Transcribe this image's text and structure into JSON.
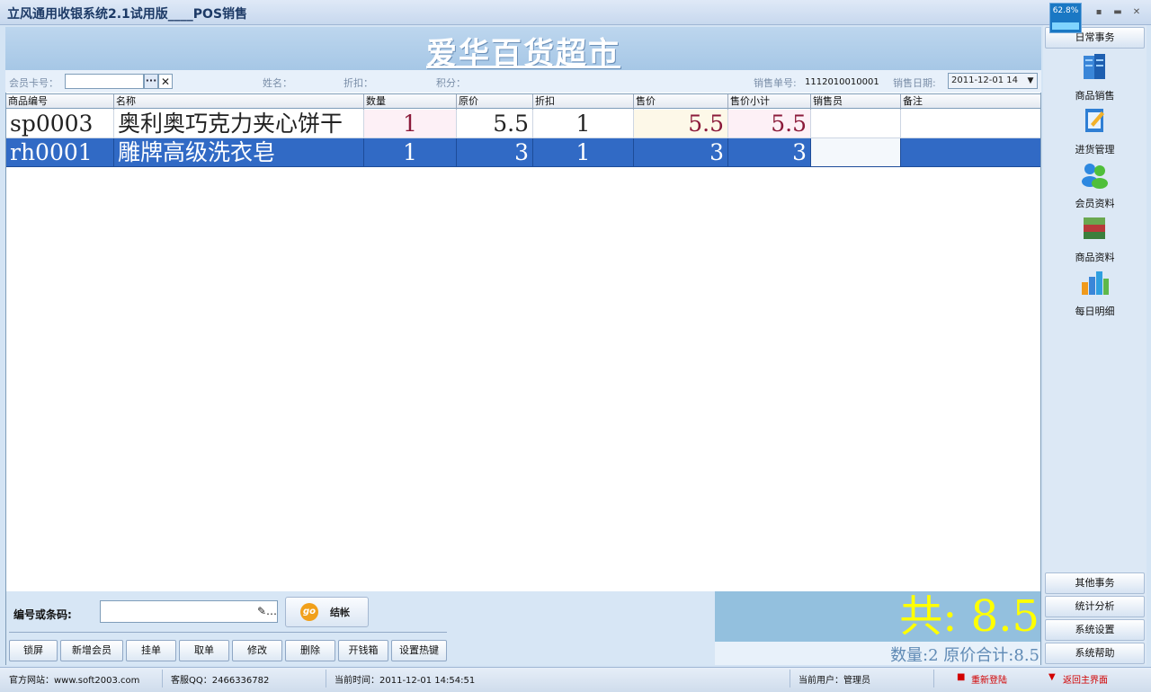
{
  "window": {
    "title": "立风通用收银系统2.1试用版____POS销售",
    "perf_value": "62.8%",
    "minimize": "▪",
    "maximize": "▬",
    "close": "✕"
  },
  "store": {
    "name": "爱华百货超市"
  },
  "member_bar": {
    "card_label": "会员卡号：",
    "card_value": "",
    "dots_label": "···",
    "clear_label": "✕",
    "name_label": "姓名：",
    "discount_label": "折扣：",
    "points_label": "积分：",
    "order_no_label": "销售单号:",
    "order_no": "1112010010001",
    "date_label": "销售日期:",
    "date_value": "2011-12-01 14",
    "date_arrow": "▼"
  },
  "grid": {
    "columns": [
      "商品编号",
      "名称",
      "数量",
      "原价",
      "折扣",
      "售价",
      "售价小计",
      "销售员",
      "备注"
    ],
    "rows": [
      {
        "code": "sp0003",
        "name": "奥利奥巧克力夹心饼干",
        "qty": "1",
        "price": "5.5",
        "discount": "1",
        "sale_price": "5.5",
        "subtotal": "5.5",
        "seller": "",
        "note": ""
      },
      {
        "code": "rh0001",
        "name": "雕牌高级洗衣皂",
        "qty": "1",
        "price": "3",
        "discount": "1",
        "sale_price": "3",
        "subtotal": "3",
        "seller": "",
        "note": ""
      }
    ]
  },
  "input_panel": {
    "code_label": "编号或条码:",
    "code_value": "",
    "search_icon": "✎…",
    "go_text": "go",
    "checkout_label": "结帐"
  },
  "function_buttons": [
    "锁屏",
    "新增会员",
    "挂单",
    "取单",
    "修改",
    "删除",
    "开钱箱",
    "设置热键"
  ],
  "totals": {
    "total": "共: 8.5",
    "summary": "数量:2  原价合计:8.5"
  },
  "sidebar": {
    "head": "日常事务",
    "items": [
      {
        "label": "商品销售",
        "icon": "building-icon"
      },
      {
        "label": "进货管理",
        "icon": "notepad-icon"
      },
      {
        "label": "会员资料",
        "icon": "users-icon"
      },
      {
        "label": "商品资料",
        "icon": "books-icon"
      },
      {
        "label": "每日明细",
        "icon": "bar-chart-icon"
      }
    ],
    "bottom": [
      "其他事务",
      "统计分析",
      "系统设置",
      "系统帮助"
    ]
  },
  "status": {
    "website": "官方网站：www.soft2003.com",
    "qq": "客服QQ：2466336782",
    "time": "当前时间：2011-12-01 14:54:51",
    "user": "当前用户：管理员",
    "relogin": "重新登陆",
    "relogin_icon": "■",
    "back_main": "返回主界面",
    "back_icon": "▼"
  },
  "colors": {
    "selected_row": "#316ac5",
    "total_text": "#ffff00",
    "total_bg": "#93c0de",
    "accent_red": "#d20000"
  }
}
